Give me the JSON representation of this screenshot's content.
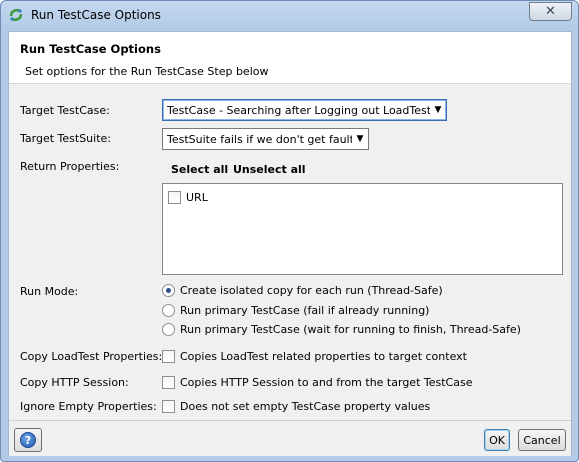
{
  "window": {
    "title": "Run TestCase Options",
    "close_glyph": "✕"
  },
  "header": {
    "title": "Run TestCase Options",
    "subtitle": "Set options for the Run TestCase Step below"
  },
  "form": {
    "target_testcase": {
      "label": "Target TestCase:",
      "value": "TestCase - Searching after Logging out LoadTests"
    },
    "target_testsuite": {
      "label": "Target TestSuite:",
      "value": "TestSuite fails if we don't get faults"
    },
    "return_properties": {
      "label": "Return Properties:",
      "select_all": "Select all",
      "unselect_all": "Unselect all",
      "items": [
        {
          "label": "URL",
          "checked": false
        }
      ]
    },
    "run_mode": {
      "label": "Run Mode:",
      "options": [
        {
          "label": "Create isolated copy for each run (Thread-Safe)",
          "selected": true
        },
        {
          "label": "Run primary TestCase (fail if already running)",
          "selected": false
        },
        {
          "label": "Run primary TestCase (wait for running to finish, Thread-Safe)",
          "selected": false
        }
      ]
    },
    "copy_loadtest": {
      "label": "Copy LoadTest Properties:",
      "text": "Copies LoadTest related properties to target context",
      "checked": false
    },
    "copy_http": {
      "label": "Copy HTTP Session:",
      "text": "Copies HTTP Session to and from the target TestCase",
      "checked": false
    },
    "ignore_empty": {
      "label": "Ignore Empty Properties:",
      "text": "Does not set empty TestCase property values",
      "checked": false
    }
  },
  "footer": {
    "help_glyph": "?",
    "ok_label": "OK",
    "cancel_label": "Cancel"
  },
  "colors": {
    "title_bar": "#b3cbe7",
    "dialog_bg": "#f0f0f0",
    "radio_dot": "#2d4f8a",
    "help_blue": "#1f5bb5"
  }
}
